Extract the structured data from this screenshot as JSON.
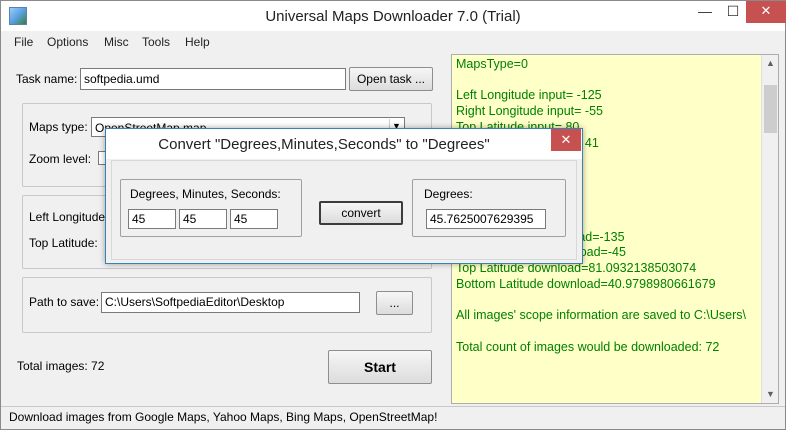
{
  "window": {
    "title": "Universal Maps Downloader 7.0 (Trial)",
    "minimize_glyph": "—",
    "maximize_glyph": "☐",
    "close_glyph": "✕"
  },
  "menu": {
    "items": [
      "File",
      "Options",
      "Misc",
      "Tools",
      "Help"
    ]
  },
  "form": {
    "task_name_label": "Task name:",
    "task_name_value": "softpedia.umd",
    "open_task_button": "Open task ...",
    "maps_type_label": "Maps type:",
    "maps_type_value": "OpenStreetMap map",
    "zoom_level_label": "Zoom level:",
    "left_longitude_label": "Left Longitude:",
    "top_latitude_label": "Top Latitude:",
    "path_label": "Path to save:",
    "path_value": "C:\\Users\\SoftpediaEditor\\Desktop",
    "browse_button": "...",
    "total_images_label": "Total images: 72",
    "start_button": "Start"
  },
  "log": {
    "lines": [
      "MapsType=0",
      "",
      "Left Longitude  input= -125",
      "Right Longitude input= -55",
      "Top Latitude    input= 80",
      "Bottom Latitude input= 41",
      "",
      "",
      "",
      "",
      "",
      "Left Longitude download=-135",
      "Right Longitude download=-45",
      "Top Latitude    download=81.0932138503074",
      "Bottom Latitude download=40.9798980661679",
      "",
      "All images' scope information are saved to C:\\Users\\",
      "",
      "Total count of images would be downloaded: 72"
    ]
  },
  "dialog": {
    "title": "Convert \"Degrees,Minutes,Seconds\" to \"Degrees\"",
    "dms_group_label": "Degrees, Minutes, Seconds:",
    "degrees_value": "45",
    "minutes_value": "45",
    "seconds_value": "45",
    "convert_button": "convert",
    "result_group_label": "Degrees:",
    "result_value": "45.7625007629395"
  },
  "status": {
    "text": "Download images from Google Maps, Yahoo Maps, Bing Maps, OpenStreetMap!"
  },
  "colors": {
    "log_background": "#ffffc8",
    "log_text": "#008000",
    "close_button": "#c75050"
  }
}
